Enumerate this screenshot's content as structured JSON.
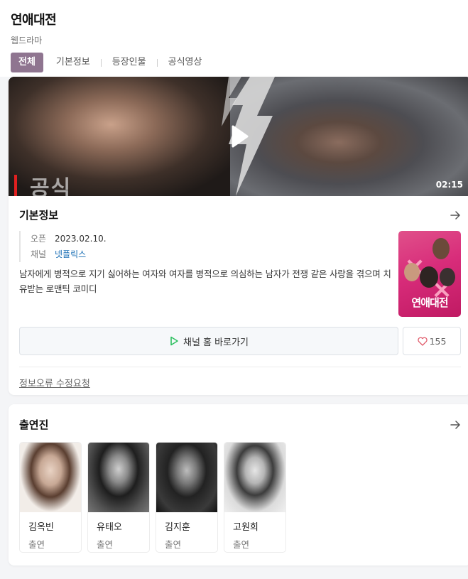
{
  "header": {
    "title": "연애대전",
    "subtitle": "웹드라마",
    "tabs": [
      {
        "label": "전체",
        "active": true
      },
      {
        "label": "기본정보",
        "active": false
      },
      {
        "label": "등장인물",
        "active": false
      },
      {
        "label": "공식영상",
        "active": false
      }
    ]
  },
  "video": {
    "duration": "02:15",
    "overlay_text": "공식"
  },
  "basic_info": {
    "section_title": "기본정보",
    "open_key": "오픈",
    "open_value": "2023.02.10.",
    "channel_key": "채널",
    "channel_value": "넷플릭스",
    "description": "남자에게 병적으로 지기 싫어하는 여자와 여자를 병적으로 의심하는 남자가 전쟁 같은 사랑을 겪으며 치유받는 로맨틱 코미디",
    "poster_title": "연애대전",
    "channel_button": "채널 홈 바로가기",
    "like_count": "155",
    "report_link": "정보오류 수정요청"
  },
  "cast": {
    "section_title": "출연진",
    "members": [
      {
        "name": "김옥빈",
        "role": "출연"
      },
      {
        "name": "유태오",
        "role": "출연"
      },
      {
        "name": "김지훈",
        "role": "출연"
      },
      {
        "name": "고원희",
        "role": "출연"
      }
    ]
  },
  "colors": {
    "active_tab": "#8f7590",
    "channel_link": "#1a6fb5",
    "play_green": "#2ec060",
    "heart_red": "#e05a6a"
  }
}
